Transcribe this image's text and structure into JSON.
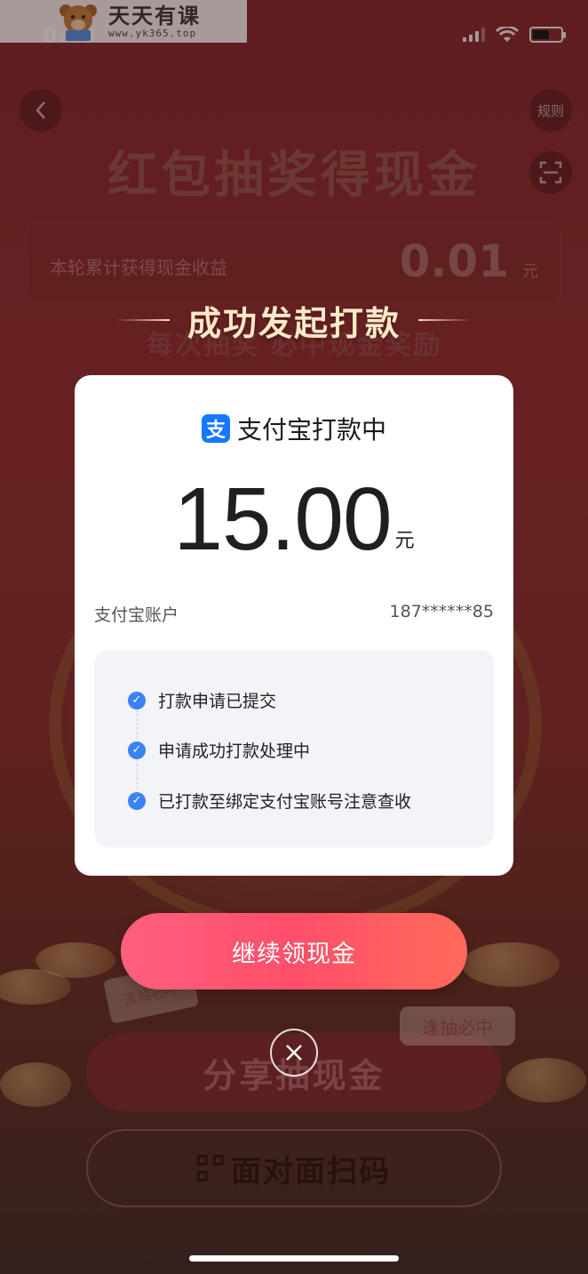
{
  "status_bar": {
    "time": "0:00"
  },
  "watermark": {
    "title": "天天有课",
    "url": "www.yk365.top"
  },
  "nav": {
    "rules_label": "规则"
  },
  "background": {
    "page_title": "红包抽奖得现金",
    "earnings_label": "本轮累计获得现金收益",
    "earnings_value": "0.01",
    "earnings_unit": "元",
    "subtitle": "每次抽奖 必中现金奖励",
    "share_button": "分享抽现金",
    "bubble": "逢抽必中",
    "sticker": "逢抽必中",
    "face_scan_button": "面对面扫码"
  },
  "dialog": {
    "heading": "成功发起打款",
    "card_title": "支付宝打款中",
    "alipay_glyph": "支",
    "amount": "15.00",
    "amount_unit": "元",
    "account_label": "支付宝账户",
    "account_value": "187******85",
    "steps": [
      {
        "text": "打款申请已提交"
      },
      {
        "text": "申请成功打款处理中"
      },
      {
        "text": "已打款至绑定支付宝账号注意查收"
      }
    ],
    "continue_button": "继续领现金"
  },
  "colors": {
    "accent": "#ff4f6a",
    "alipay_blue": "#1677ff",
    "check_blue": "#3b82f6",
    "heading_gold": "#ffe9c7"
  }
}
